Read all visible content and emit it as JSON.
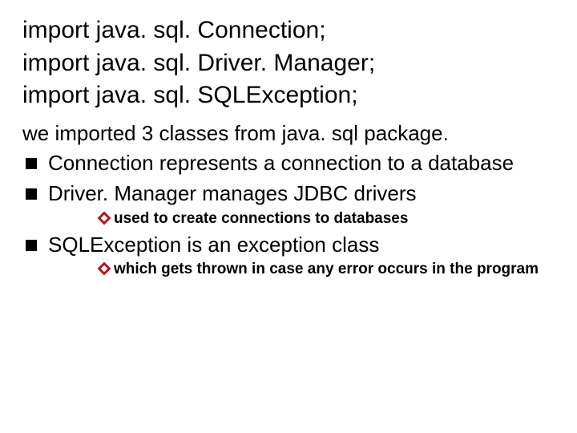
{
  "imports": [
    {
      "prefix": "import java. sql. ",
      "cls": "Connection",
      "suffix": ";"
    },
    {
      "prefix": "import java. sql. ",
      "cls": "Driver. Manager",
      "suffix": ";"
    },
    {
      "prefix": "import java. sql. ",
      "cls": "SQLException",
      "suffix": ";"
    }
  ],
  "lead": "we imported 3 classes from java. sql  package.",
  "bullets": [
    {
      "text": "Connection represents a connection to a database",
      "subs": []
    },
    {
      "text": "Driver. Manager manages JDBC drivers",
      "subs": [
        "used to create connections to databases"
      ]
    },
    {
      "text": "SQLException is an exception class",
      "subs": [
        "which gets thrown in case any error occurs in the program"
      ]
    }
  ]
}
